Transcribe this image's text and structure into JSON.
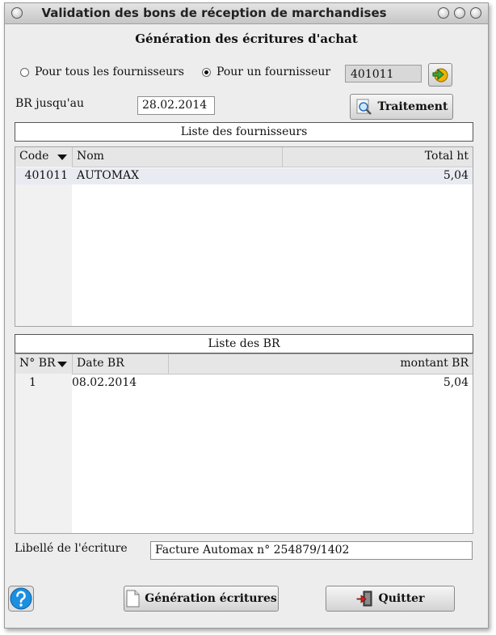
{
  "window": {
    "title": "Validation des bons de réception de marchandises",
    "subtitle": "Génération des écritures d'achat"
  },
  "filters": {
    "radio_all": {
      "label": "Pour tous les fournisseurs",
      "selected": false
    },
    "radio_one": {
      "label": "Pour un fournisseur",
      "selected": true
    },
    "supplier_code": "401011",
    "br_until_label": "BR jusqu'au",
    "br_until_value": "28.02.2014",
    "process_button": "Traitement"
  },
  "suppliers": {
    "section_title": "Liste des fournisseurs",
    "columns": [
      "Code",
      "Nom",
      "Total ht"
    ],
    "rows": [
      {
        "code": "401011",
        "name": "AUTOMAX",
        "total": "5,04"
      }
    ]
  },
  "receipts": {
    "section_title": "Liste des BR",
    "columns": [
      "N° BR",
      "Date BR",
      "montant BR"
    ],
    "rows": [
      {
        "number": "1",
        "date": "08.02.2014",
        "amount": "5,04"
      }
    ]
  },
  "entry": {
    "label": "Libellé de l'écriture",
    "value": "Facture Automax n° 254879/1402"
  },
  "footer": {
    "generate_button": "Génération écritures",
    "quit_button": "Quitter"
  },
  "colors": {
    "window_bg": "#ededed",
    "selected_row": "#e9ebf3",
    "help_blue": "#1b8fe0"
  }
}
